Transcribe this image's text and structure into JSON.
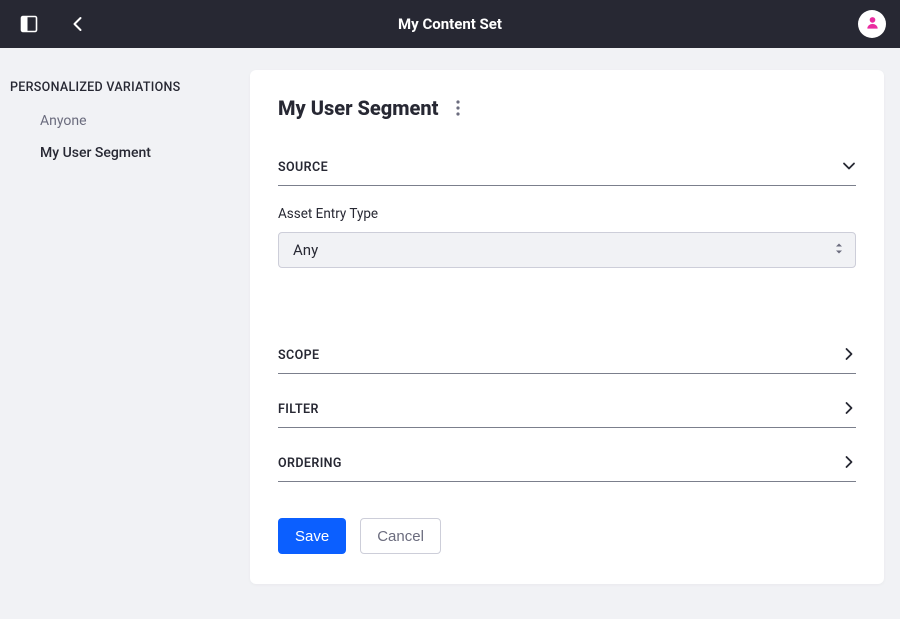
{
  "topbar": {
    "title": "My Content Set"
  },
  "sidebar": {
    "heading": "PERSONALIZED VARIATIONS",
    "items": [
      {
        "label": "Anyone",
        "active": false
      },
      {
        "label": "My User Segment",
        "active": true
      }
    ]
  },
  "card": {
    "title": "My User Segment"
  },
  "sections": {
    "source": {
      "label": "SOURCE",
      "assetEntryTypeLabel": "Asset Entry Type",
      "assetEntryTypeValue": "Any"
    },
    "scope": {
      "label": "SCOPE"
    },
    "filter": {
      "label": "FILTER"
    },
    "ordering": {
      "label": "ORDERING"
    }
  },
  "actions": {
    "save": "Save",
    "cancel": "Cancel"
  }
}
